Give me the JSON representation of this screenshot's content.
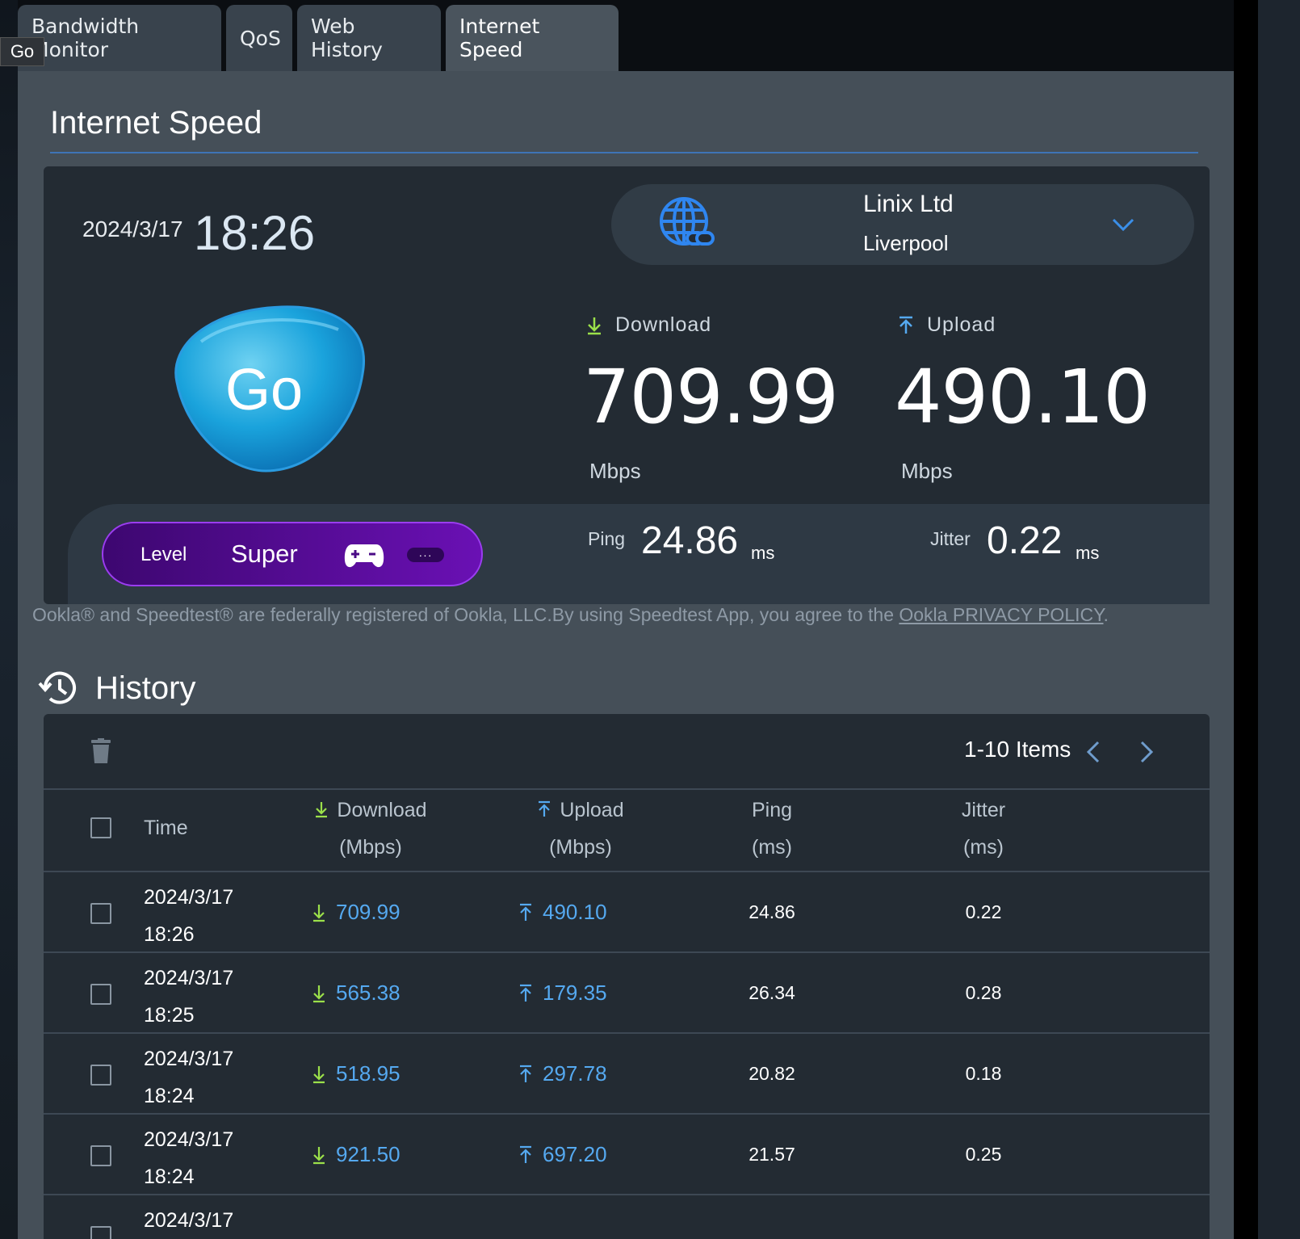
{
  "tooltip": "Go",
  "tabs": [
    {
      "label": "Bandwidth Monitor"
    },
    {
      "label": "QoS"
    },
    {
      "label": "Web History"
    },
    {
      "label": "Internet Speed"
    }
  ],
  "page_title": "Internet Speed",
  "result": {
    "date": "2024/3/17",
    "time": "18:26",
    "server_name": "Linix Ltd",
    "server_city": "Liverpool",
    "go_label": "Go",
    "download_label": "Download",
    "download_value": "709.99",
    "download_unit": "Mbps",
    "upload_label": "Upload",
    "upload_value": "490.10",
    "upload_unit": "Mbps",
    "level_label": "Level",
    "level_value": "Super",
    "more_label": "···",
    "ping_label": "Ping",
    "ping_value": "24.86",
    "ping_unit": "ms",
    "jitter_label": "Jitter",
    "jitter_value": "0.22",
    "jitter_unit": "ms"
  },
  "legal": {
    "text": "Ookla® and Speedtest® are federally registered of Ookla, LLC.By using Speedtest App, you agree to the ",
    "link": "Ookla PRIVACY POLICY",
    "end": "."
  },
  "history": {
    "title": "History",
    "pager": "1-10 Items",
    "columns": {
      "time": "Time",
      "download": "Download",
      "download_unit": "(Mbps)",
      "upload": "Upload",
      "upload_unit": "(Mbps)",
      "ping": "Ping",
      "ping_unit": "(ms)",
      "jitter": "Jitter",
      "jitter_unit": "(ms)"
    },
    "rows": [
      {
        "date": "2024/3/17",
        "time": "18:26",
        "download": "709.99",
        "upload": "490.10",
        "ping": "24.86",
        "jitter": "0.22"
      },
      {
        "date": "2024/3/17",
        "time": "18:25",
        "download": "565.38",
        "upload": "179.35",
        "ping": "26.34",
        "jitter": "0.28"
      },
      {
        "date": "2024/3/17",
        "time": "18:24",
        "download": "518.95",
        "upload": "297.78",
        "ping": "20.82",
        "jitter": "0.18"
      },
      {
        "date": "2024/3/17",
        "time": "18:24",
        "download": "921.50",
        "upload": "697.20",
        "ping": "21.57",
        "jitter": "0.25"
      },
      {
        "date": "2024/3/17",
        "time": "",
        "download": "",
        "upload": "",
        "ping": "",
        "jitter": ""
      }
    ]
  },
  "colors": {
    "accent_blue": "#55a9f0",
    "download_arrow": "#9be04a",
    "upload_arrow": "#55a9f0",
    "level_purple": "#6a10b4"
  }
}
